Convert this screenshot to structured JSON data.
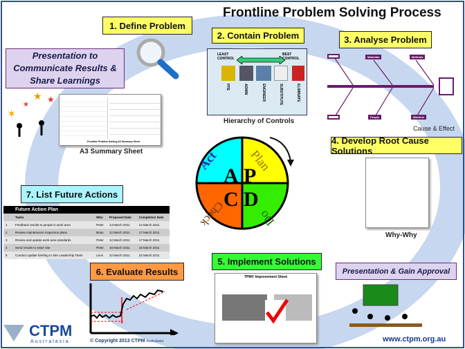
{
  "title": "Frontline Problem Solving Process",
  "steps": {
    "s1": "1. Define Problem",
    "s2": "2. Contain Problem",
    "s3": "3. Analyse Problem",
    "s4": "4. Develop Root Cause Solutions",
    "s5": "5. Implement Solutions",
    "s6": "6. Evaluate Results",
    "s7": "7. List Future Actions"
  },
  "presentation_results": "Presentation to Communicate Results & Share Learnings",
  "presentation_approval": "Presentation & Gain Approval",
  "hierarchy": {
    "caption": "Hierarchy of Controls",
    "least": "LEAST CONTROL",
    "best": "BEST CONTROL",
    "items": [
      "PPE",
      "ADMIN",
      "ENGINEER",
      "SUBSTITUTE",
      "ELIMINATE"
    ]
  },
  "fishbone": {
    "caption": "Cause & Effect",
    "labels": [
      "Materials",
      "Methods",
      "People",
      "Machine"
    ]
  },
  "a3": {
    "caption": "A3 Summary Sheet",
    "sheet_title": "Frontline Problem Solving A3 Summary Sheet"
  },
  "whywhy": {
    "caption": "Why-Why"
  },
  "pdca": {
    "act": "Act",
    "plan": "Plan",
    "do": "Do",
    "check": "Check",
    "a": "A",
    "p": "P",
    "c": "C",
    "d": "D",
    "colors": {
      "act": "#00ffff",
      "plan": "#ffff00",
      "do": "#33ee00",
      "check": "#ff6600"
    }
  },
  "action_plan": {
    "title": "Future Action Plan",
    "headers": [
      "Tasks",
      "Who",
      "Proposed Date",
      "Completion Date"
    ],
    "rows": [
      [
        "1",
        "Feedback results to people in work area",
        "Peter",
        "14 March 2011",
        "14 March 2011"
      ],
      [
        "2",
        "Review maintenance inspection plans",
        "Brian",
        "12 March 2011",
        "17 March 2011"
      ],
      [
        "3",
        "Review and update work area standards",
        "Peter",
        "12 March 2011",
        "17 March 2011"
      ],
      [
        "4",
        "Send results to sister site",
        "Peter",
        "18 March 2011",
        "18 March 2011"
      ],
      [
        "5",
        "Conduct update briefing to Site Leadership Team",
        "Leon",
        "22 March 2011",
        "22 March 2011"
      ]
    ]
  },
  "improvement_sheet": {
    "title": "TPM® Improvement Sheet"
  },
  "logo": {
    "name": "CTPM",
    "sub": "Australasia"
  },
  "copyright": "© Copyright 2013 CTPM",
  "copyright_sub": "Australasia",
  "website": "www.ctpm.org.au"
}
